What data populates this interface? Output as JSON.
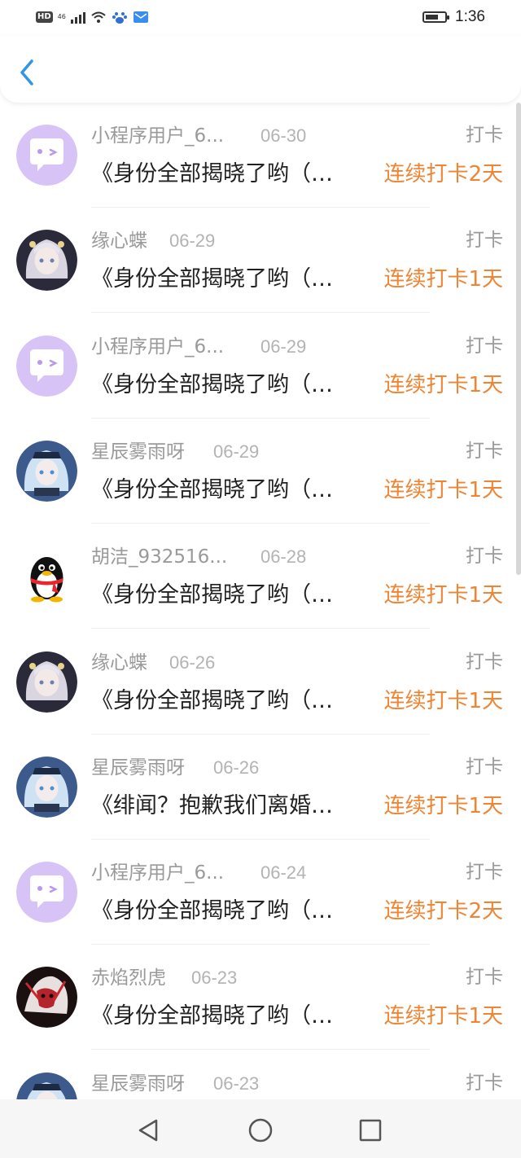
{
  "status_bar": {
    "hd": "HD",
    "network": "46",
    "time": "1:36",
    "battery_level": 0.7,
    "icons": [
      "hd-icon",
      "signal-icon",
      "wifi-icon",
      "baidu-icon",
      "mail-icon",
      "battery-icon"
    ]
  },
  "header": {
    "back_icon": "chevron-left-icon",
    "accent": "#2d96e6"
  },
  "colors": {
    "streak": "#ef8433",
    "muted": "#9a9a9a",
    "title": "#222222",
    "bot_avatar_bg": "#d8c3f7"
  },
  "items": [
    {
      "user": "小程序用户_6...",
      "date": "06-30",
      "type": "打卡",
      "title": "《身份全部揭晓了哟（…",
      "streak": "连续打卡2天",
      "avatar": "bot-avatar"
    },
    {
      "user": "缘心蝶",
      "date": "06-29",
      "type": "打卡",
      "title": "《身份全部揭晓了哟（…",
      "streak": "连续打卡1天",
      "avatar": "anime-girl-white"
    },
    {
      "user": "小程序用户_6...",
      "date": "06-29",
      "type": "打卡",
      "title": "《身份全部揭晓了哟（…",
      "streak": "连续打卡1天",
      "avatar": "bot-avatar"
    },
    {
      "user": "星辰雾雨呀",
      "date": "06-29",
      "type": "打卡",
      "title": "《身份全部揭晓了哟（…",
      "streak": "连续打卡1天",
      "avatar": "anime-girl-blue"
    },
    {
      "user": "胡洁_932516...",
      "date": "06-28",
      "type": "打卡",
      "title": "《身份全部揭晓了哟（…",
      "streak": "连续打卡1天",
      "avatar": "qq-penguin"
    },
    {
      "user": "缘心蝶",
      "date": "06-26",
      "type": "打卡",
      "title": "《身份全部揭晓了哟（…",
      "streak": "连续打卡1天",
      "avatar": "anime-girl-white"
    },
    {
      "user": "星辰雾雨呀",
      "date": "06-26",
      "type": "打卡",
      "title": "《绯闻？抱歉我们离婚…",
      "streak": "连续打卡1天",
      "avatar": "anime-girl-blue"
    },
    {
      "user": "小程序用户_6...",
      "date": "06-24",
      "type": "打卡",
      "title": "《身份全部揭晓了哟（…",
      "streak": "连续打卡2天",
      "avatar": "bot-avatar"
    },
    {
      "user": "赤焰烈虎",
      "date": "06-23",
      "type": "打卡",
      "title": "《身份全部揭晓了哟（…",
      "streak": "连续打卡1天",
      "avatar": "dark-red-avatar"
    },
    {
      "user": "星辰雾雨呀",
      "date": "06-23",
      "type": "打卡",
      "title": "",
      "streak": "",
      "avatar": "anime-girl-blue"
    }
  ],
  "nav": {
    "icons": [
      "back-triangle-icon",
      "home-circle-icon",
      "recents-square-icon"
    ]
  }
}
